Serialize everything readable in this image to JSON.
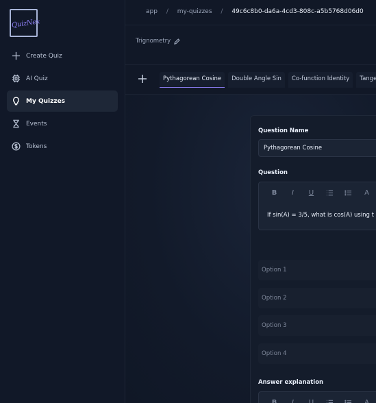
{
  "brand": {
    "logo_text": "QuizNex"
  },
  "sidebar": {
    "items": [
      {
        "label": "Create Quiz",
        "icon": "plus-icon",
        "active": false
      },
      {
        "label": "AI Quiz",
        "icon": "chip-icon",
        "active": false
      },
      {
        "label": "My Quizzes",
        "icon": "lightbulb-icon",
        "active": true
      },
      {
        "label": "Events",
        "icon": "hourglass-icon",
        "active": false
      },
      {
        "label": "Tokens",
        "icon": "dollar-circle-icon",
        "active": false
      }
    ]
  },
  "breadcrumb": {
    "items": [
      "app",
      "my-quizzes",
      "49c6c8b0-da6a-4cd3-808c-a5b5768d06d0"
    ],
    "separator": "/"
  },
  "quiz": {
    "name": "Trignometry"
  },
  "tabs": [
    {
      "label": "Pythagorean Cosine",
      "active": true
    },
    {
      "label": "Double Angle Sin",
      "active": false
    },
    {
      "label": "Co-function Identity",
      "active": false
    },
    {
      "label": "Tangent",
      "active": false
    }
  ],
  "form": {
    "question_name_label": "Question Name",
    "question_name_value": "Pythagorean Cosine",
    "question_label": "Question",
    "question_text": "If sin(A) = 3/5, what is cos(A) using t",
    "options": [
      {
        "placeholder": "Option 1"
      },
      {
        "placeholder": "Option 2"
      },
      {
        "placeholder": "Option 3"
      },
      {
        "placeholder": "Option 4"
      }
    ],
    "answer_explanation_label": "Answer explanation"
  },
  "colors": {
    "accent": "#8a7cf0",
    "background": "#101726",
    "sidebar_bg": "#111828",
    "active_item_bg": "#1e2737"
  }
}
